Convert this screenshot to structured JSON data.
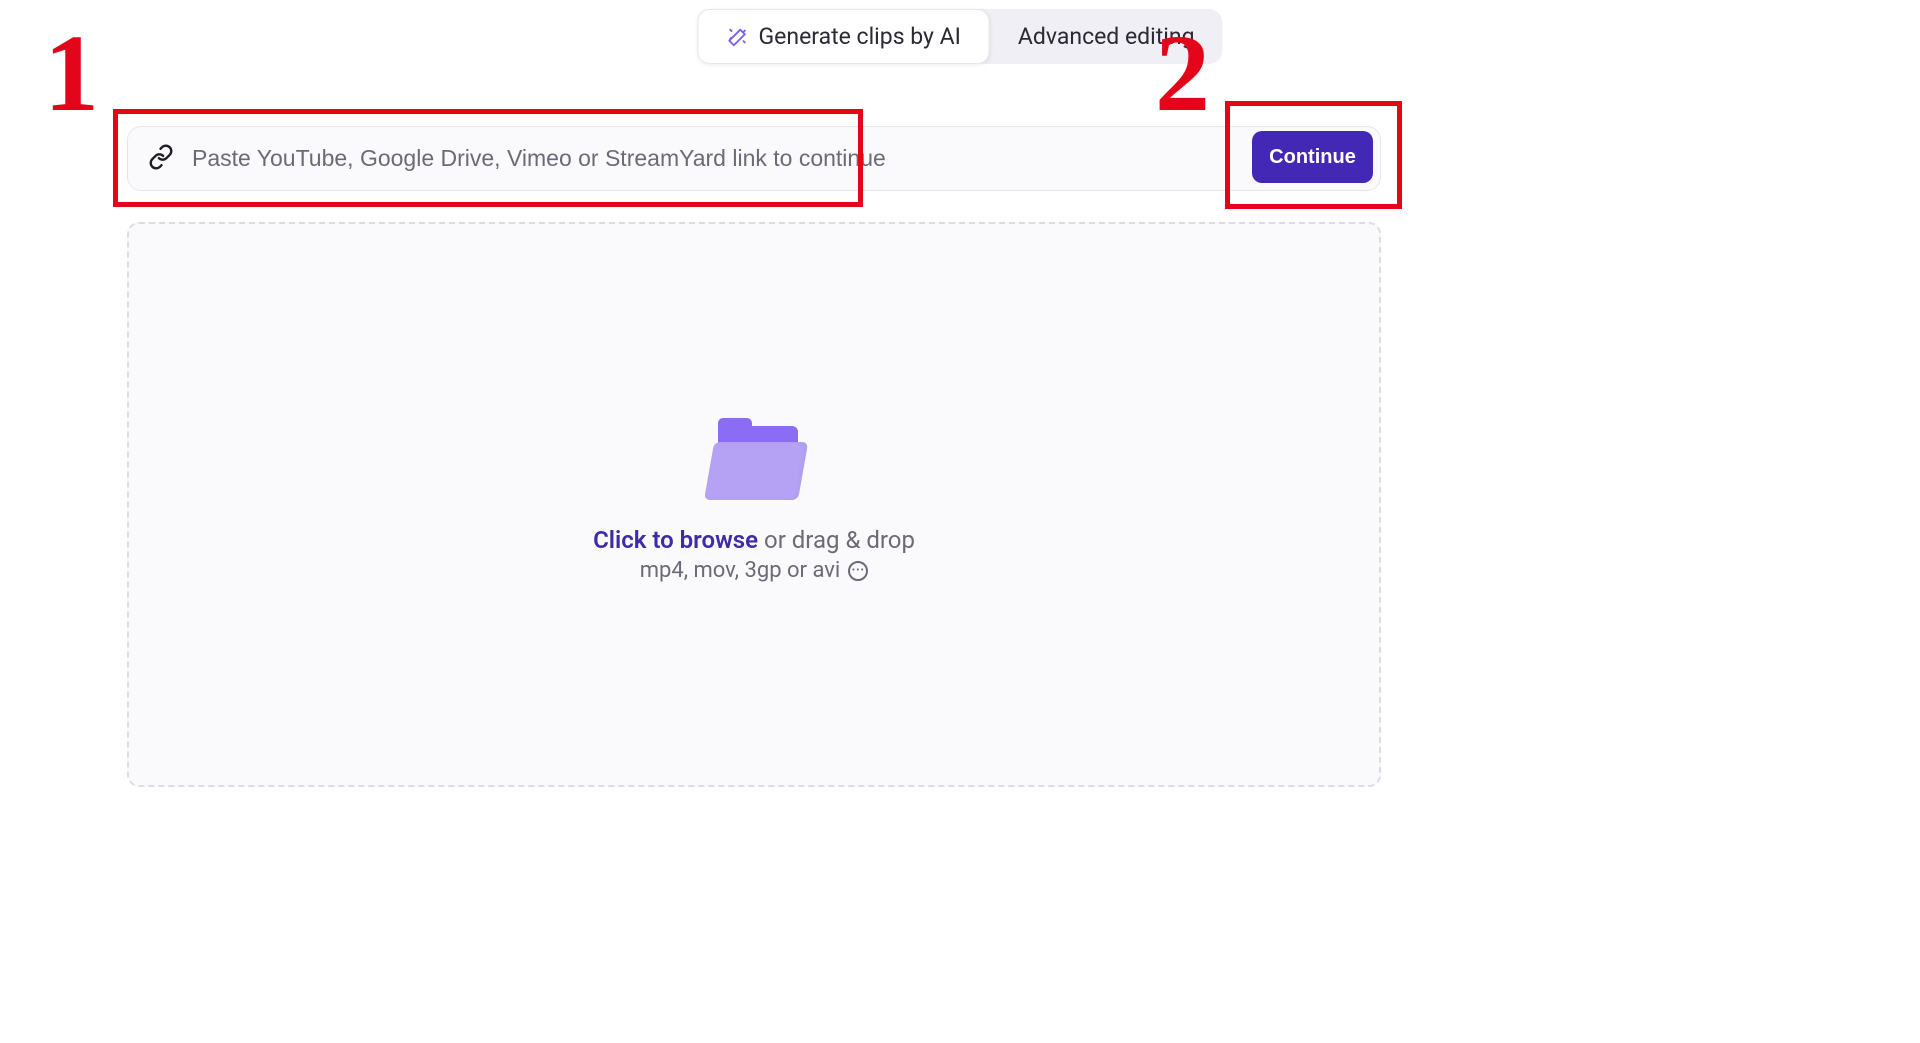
{
  "tabs": {
    "generate": "Generate clips by AI",
    "advanced": "Advanced editing"
  },
  "url_bar": {
    "placeholder": "Paste YouTube, Google Drive, Vimeo or StreamYard link to continue",
    "continue": "Continue"
  },
  "dropzone": {
    "browse": "Click to browse",
    "drag": " or drag & drop",
    "formats": "mp4, mov, 3gp or avi"
  },
  "annotations": {
    "one": "1",
    "two": "2"
  }
}
